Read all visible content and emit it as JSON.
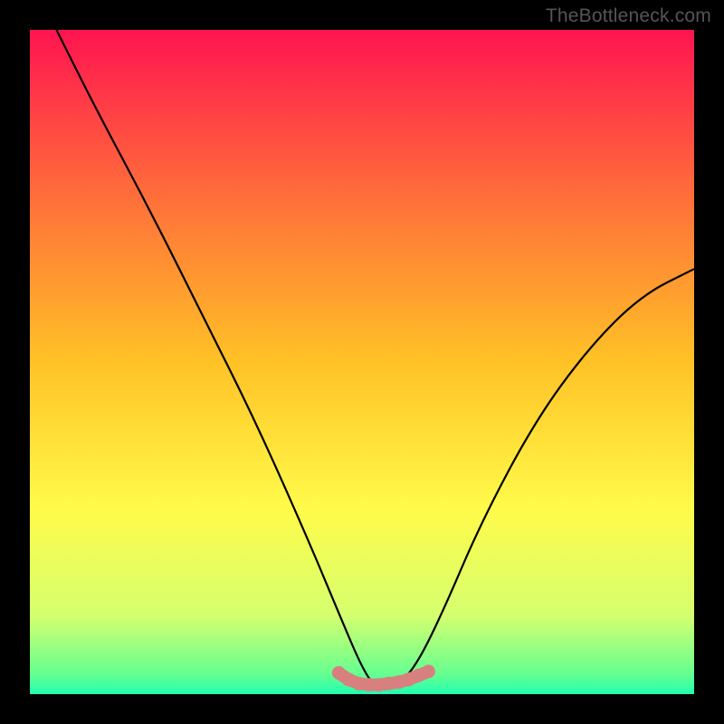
{
  "watermark": "TheBottleneck.com",
  "chart_data": {
    "type": "line",
    "title": "",
    "xlabel": "",
    "ylabel": "",
    "xlim": [
      0,
      100
    ],
    "ylim": [
      0,
      100
    ],
    "background_gradient": {
      "stops": [
        {
          "offset": 0,
          "color": "#ff1450"
        },
        {
          "offset": 25,
          "color": "#ff6e3a"
        },
        {
          "offset": 50,
          "color": "#ffc226"
        },
        {
          "offset": 72,
          "color": "#fffb4a"
        },
        {
          "offset": 88,
          "color": "#d6ff6e"
        },
        {
          "offset": 97,
          "color": "#66ff90"
        },
        {
          "offset": 100,
          "color": "#20ffb0"
        }
      ]
    },
    "series": [
      {
        "name": "bottleneck-curve",
        "color": "#000000",
        "x": [
          4,
          10,
          18,
          26,
          34,
          42,
          47,
          50,
          52,
          55,
          58,
          62,
          68,
          76,
          84,
          92,
          100
        ],
        "y": [
          100,
          88,
          73,
          57,
          41,
          23,
          11,
          4,
          1,
          1,
          4,
          12,
          26,
          41,
          52,
          60,
          64
        ]
      },
      {
        "name": "bottom-marker",
        "color": "#d88080",
        "type": "scatter",
        "x": [
          46.5,
          48,
          49.5,
          51,
          52.5,
          54,
          55.5,
          57,
          58.5,
          60
        ],
        "y": [
          3.2,
          2.2,
          1.6,
          1.4,
          1.4,
          1.6,
          1.8,
          2.2,
          2.8,
          3.4
        ]
      }
    ]
  }
}
